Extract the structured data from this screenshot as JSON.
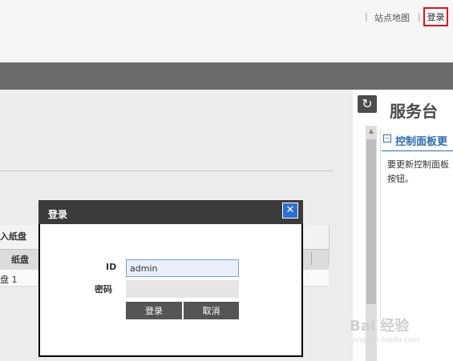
{
  "header": {
    "separator": "|",
    "sitemap_label": "站点地图",
    "login_label": "登录"
  },
  "content": {
    "tray_title": "入纸盘",
    "tray_column": "纸盘",
    "tray_value": "盘 1"
  },
  "service_desk": {
    "title": "服务台",
    "section_title": "控制面板更",
    "section_body_line1": "要更新控制面板",
    "section_body_line2": "按钮。"
  },
  "dialog": {
    "title": "登录",
    "id_label": "ID",
    "id_value": "admin",
    "password_label": "密码",
    "password_value": "",
    "login_button": "登录",
    "cancel_button": "取消"
  },
  "watermark": {
    "text": "Bai 经验",
    "url": "jingyan.baidu.com"
  }
}
